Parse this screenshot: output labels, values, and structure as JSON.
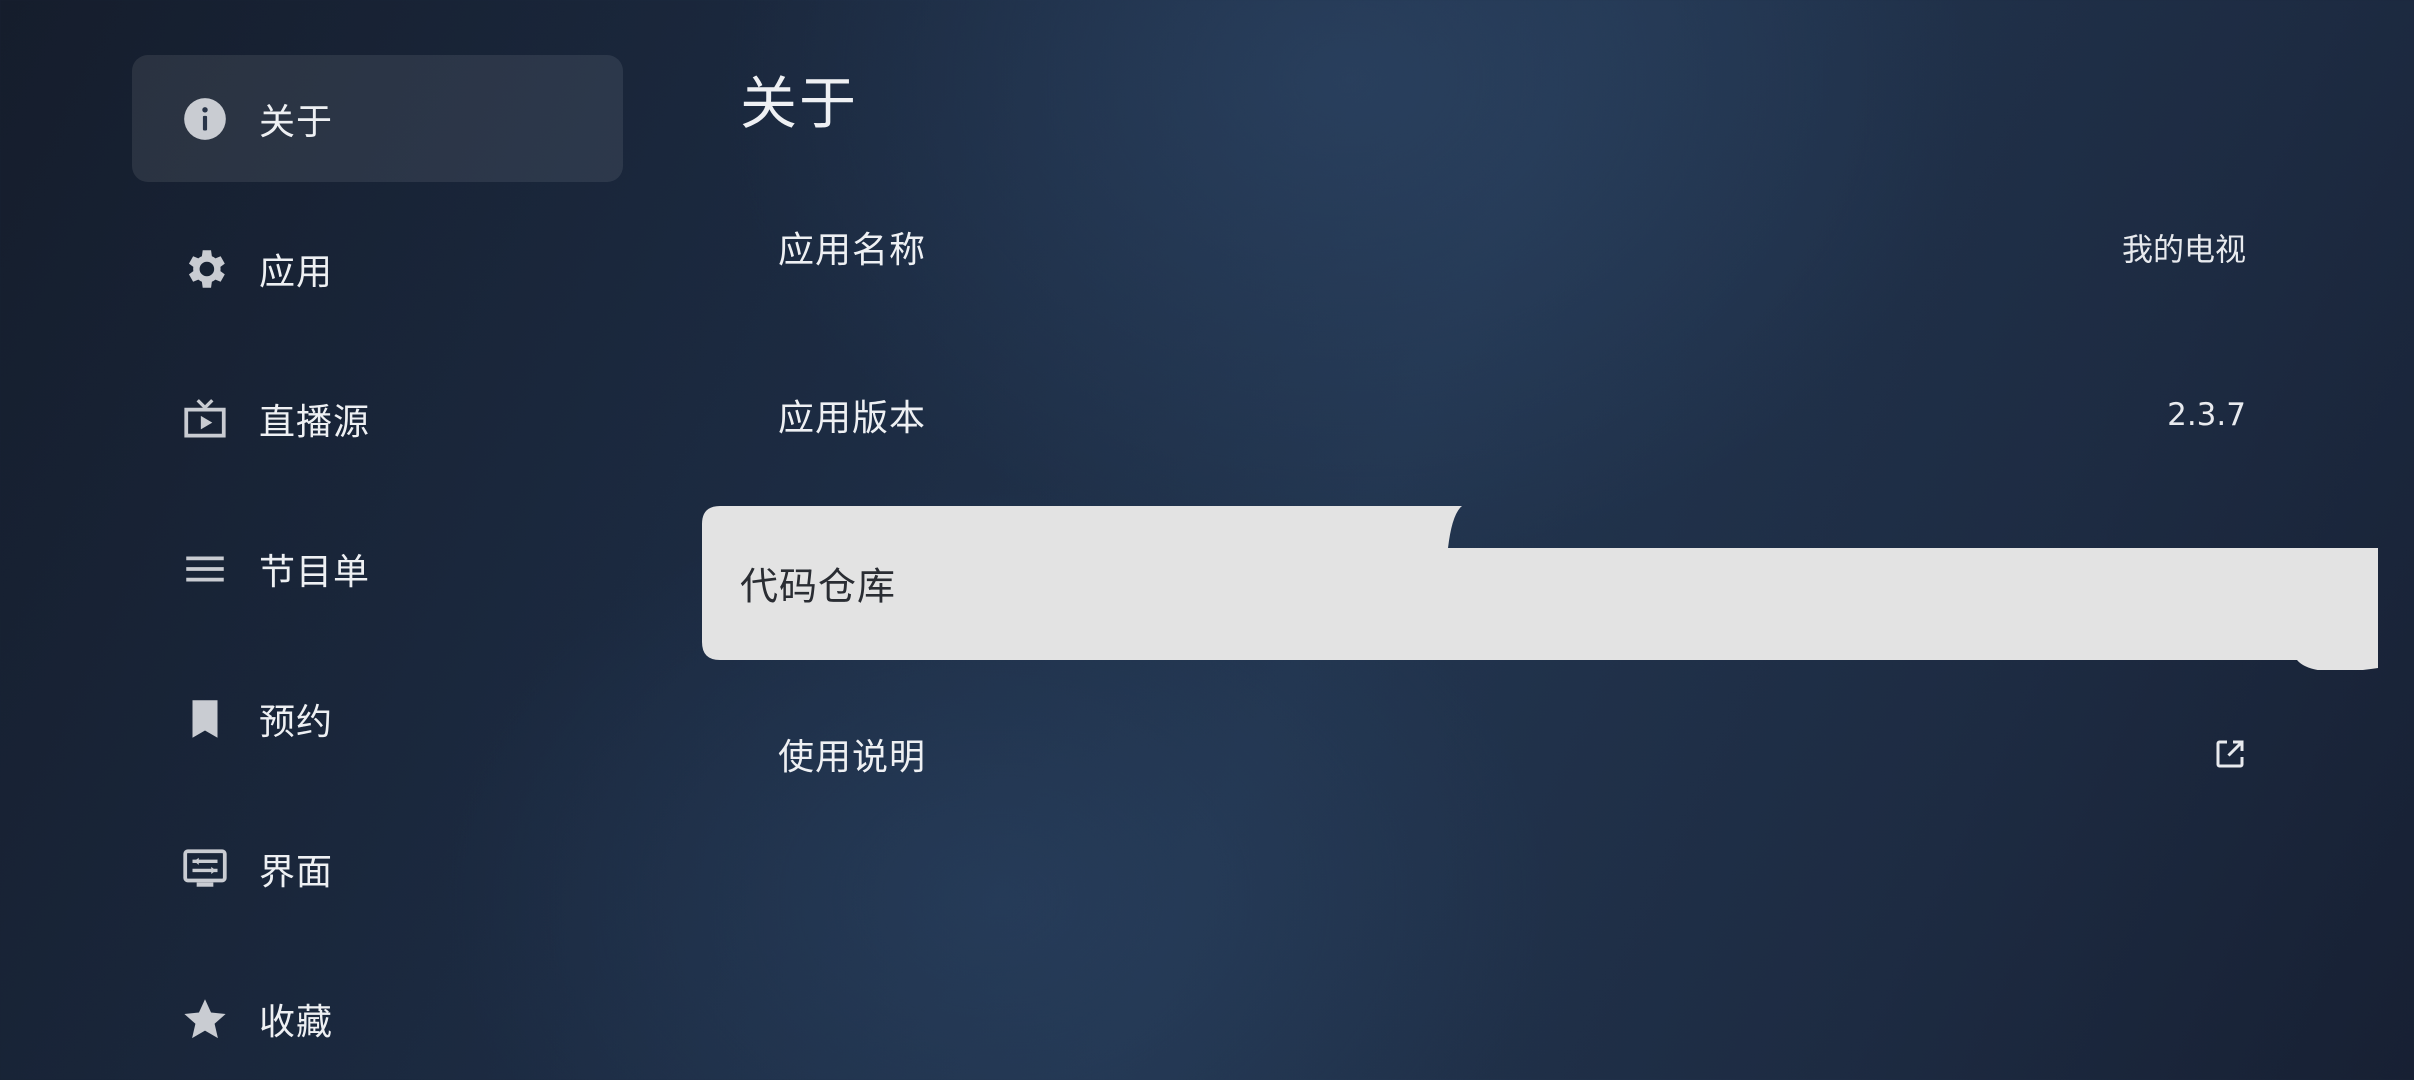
{
  "sidebar": {
    "items": [
      {
        "label": "关于",
        "icon": "info-icon",
        "active": true
      },
      {
        "label": "应用",
        "icon": "gear-icon",
        "active": false
      },
      {
        "label": "直播源",
        "icon": "live-tv-icon",
        "active": false
      },
      {
        "label": "节目单",
        "icon": "list-icon",
        "active": false
      },
      {
        "label": "预约",
        "icon": "bookmark-icon",
        "active": false
      },
      {
        "label": "界面",
        "icon": "display-settings-icon",
        "active": false
      },
      {
        "label": "收藏",
        "icon": "star-icon",
        "active": false
      }
    ]
  },
  "main": {
    "title": "关于",
    "rows": [
      {
        "label": "应用名称",
        "value": "我的电视"
      },
      {
        "label": "应用版本",
        "value": "2.3.7"
      },
      {
        "label": "代码仓库",
        "value": ""
      },
      {
        "label": "使用说明",
        "value": "",
        "icon": "open-in-new-icon"
      }
    ]
  },
  "colors": {
    "background_dark": "#151d2c",
    "background_mid": "#22354f",
    "focus_surface": "#e3e3e3",
    "text_light": "#eef0f3",
    "text_dark": "#2a2d33",
    "icon_color": "#c9ccd2"
  }
}
